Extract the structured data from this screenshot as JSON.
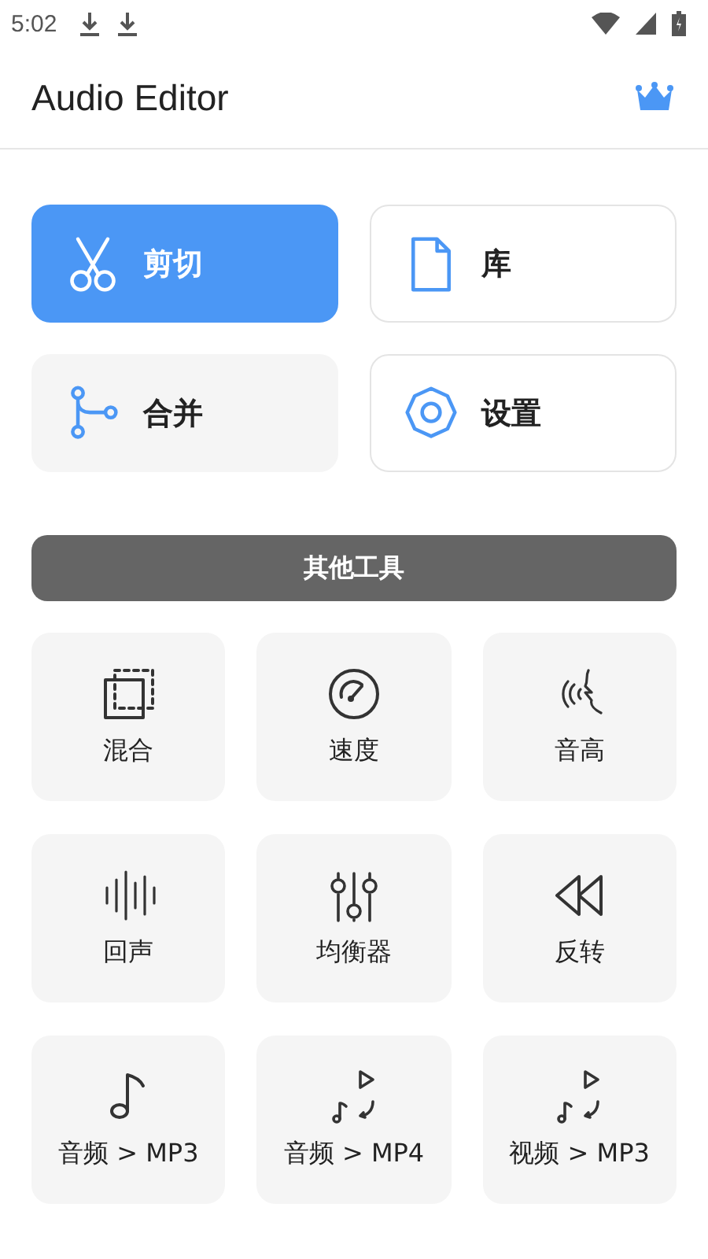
{
  "status_bar": {
    "time": "5:02"
  },
  "app_bar": {
    "title": "Audio Editor"
  },
  "main_tools": [
    {
      "label": "剪切",
      "selected": true,
      "outlined": false
    },
    {
      "label": "库",
      "selected": false,
      "outlined": true
    },
    {
      "label": "合并",
      "selected": false,
      "outlined": false
    },
    {
      "label": "设置",
      "selected": false,
      "outlined": true
    }
  ],
  "section_header": "其他工具",
  "other_tools": [
    {
      "label": "混合"
    },
    {
      "label": "速度"
    },
    {
      "label": "音高"
    },
    {
      "label": "回声"
    },
    {
      "label": "均衡器"
    },
    {
      "label": "反转"
    },
    {
      "label": "音频 > MP3"
    },
    {
      "label": "音频 > MP4"
    },
    {
      "label": "视频 > MP3"
    }
  ]
}
